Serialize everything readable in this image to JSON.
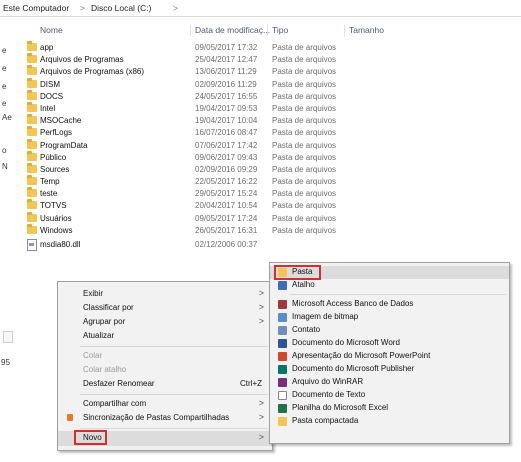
{
  "breadcrumb": {
    "items": [
      "Este Computador",
      "Disco Local (C:)"
    ],
    "separator": ">"
  },
  "columns": {
    "name": "Nome",
    "date": "Data de modificaç...",
    "type": "Tipo",
    "size": "Tamanho"
  },
  "files": [
    {
      "name": "app",
      "date": "09/05/2017 17:32",
      "type": "Pasta de arquivos",
      "icon": "folder-icon"
    },
    {
      "name": "Arquivos de Programas",
      "date": "25/04/2017 12:47",
      "type": "Pasta de arquivos",
      "icon": "folder-icon"
    },
    {
      "name": "Arquivos de Programas (x86)",
      "date": "13/06/2017 11:29",
      "type": "Pasta de arquivos",
      "icon": "folder-icon"
    },
    {
      "name": "DISM",
      "date": "02/09/2016 11:29",
      "type": "Pasta de arquivos",
      "icon": "folder-icon"
    },
    {
      "name": "DOCS",
      "date": "24/05/2017 16:55",
      "type": "Pasta de arquivos",
      "icon": "folder-icon"
    },
    {
      "name": "Intel",
      "date": "19/04/2017 09:53",
      "type": "Pasta de arquivos",
      "icon": "folder-icon"
    },
    {
      "name": "MSOCache",
      "date": "19/04/2017 10:04",
      "type": "Pasta de arquivos",
      "icon": "folder-icon"
    },
    {
      "name": "PerfLogs",
      "date": "16/07/2016 08:47",
      "type": "Pasta de arquivos",
      "icon": "folder-icon"
    },
    {
      "name": "ProgramData",
      "date": "07/06/2017 17:42",
      "type": "Pasta de arquivos",
      "icon": "folder-icon"
    },
    {
      "name": "Público",
      "date": "09/06/2017 09:43",
      "type": "Pasta de arquivos",
      "icon": "folder-icon"
    },
    {
      "name": "Sources",
      "date": "02/09/2016 09:29",
      "type": "Pasta de arquivos",
      "icon": "folder-icon"
    },
    {
      "name": "Temp",
      "date": "22/05/2017 16:22",
      "type": "Pasta de arquivos",
      "icon": "folder-icon"
    },
    {
      "name": "teste",
      "date": "29/05/2017 15:24",
      "type": "Pasta de arquivos",
      "icon": "folder-icon"
    },
    {
      "name": "TOTVS",
      "date": "20/04/2017 10:54",
      "type": "Pasta de arquivos",
      "icon": "folder-icon"
    },
    {
      "name": "Usuários",
      "date": "09/05/2017 17:24",
      "type": "Pasta de arquivos",
      "icon": "folder-icon"
    },
    {
      "name": "Windows",
      "date": "26/05/2017 16:31",
      "type": "Pasta de arquivos",
      "icon": "folder-icon"
    },
    {
      "name": "msdia80.dll",
      "date": "02/12/2006 00:37",
      "type": "",
      "icon": "dll-file-icon"
    }
  ],
  "navpane": {
    "fragments": [
      "e",
      "e",
      "e",
      "e",
      "Ae",
      "",
      "o",
      "N"
    ],
    "number": "95"
  },
  "context_menu": {
    "items": [
      {
        "label": "Exibir",
        "arrow": ">"
      },
      {
        "label": "Classificar por",
        "arrow": ">"
      },
      {
        "label": "Agrupar por",
        "arrow": ">"
      },
      {
        "label": "Atualizar"
      },
      {
        "label": "Colar",
        "disabled": true
      },
      {
        "label": "Colar atalho",
        "disabled": true
      },
      {
        "label": "Desfazer Renomear",
        "shortcut": "Ctrl+Z"
      },
      {
        "label": "Compartilhar com",
        "arrow": ">"
      },
      {
        "label": "Sincronização de Pastas Compartilhadas",
        "arrow": ">"
      },
      {
        "label": "Novo",
        "arrow": ">"
      }
    ]
  },
  "new_submenu": {
    "items": [
      {
        "label": "Pasta",
        "icon": "folder-icon",
        "color": "#f3c552"
      },
      {
        "label": "Atalho",
        "icon": "shortcut-icon",
        "color": "#3a6fb5"
      },
      {
        "label": "Microsoft Access Banco de Dados",
        "icon": "access-icon",
        "color": "#a4373a"
      },
      {
        "label": "Imagem de bitmap",
        "icon": "bitmap-icon",
        "color": "#5b8ec9"
      },
      {
        "label": "Contato",
        "icon": "contact-icon",
        "color": "#6f8fb8"
      },
      {
        "label": "Documento do Microsoft Word",
        "icon": "word-icon",
        "color": "#2b579a"
      },
      {
        "label": "Apresentação do Microsoft PowerPoint",
        "icon": "powerpoint-icon",
        "color": "#d24726"
      },
      {
        "label": "Documento do Microsoft Publisher",
        "icon": "publisher-icon",
        "color": "#077568"
      },
      {
        "label": "Arquivo do WinRAR",
        "icon": "winrar-icon",
        "color": "#7a2f7a"
      },
      {
        "label": "Documento de Texto",
        "icon": "text-icon",
        "color": "#ffffff"
      },
      {
        "label": "Planilha do Microsoft Excel",
        "icon": "excel-icon",
        "color": "#217346"
      },
      {
        "label": "Pasta compactada",
        "icon": "zip-folder-icon",
        "color": "#f3c552"
      }
    ]
  }
}
